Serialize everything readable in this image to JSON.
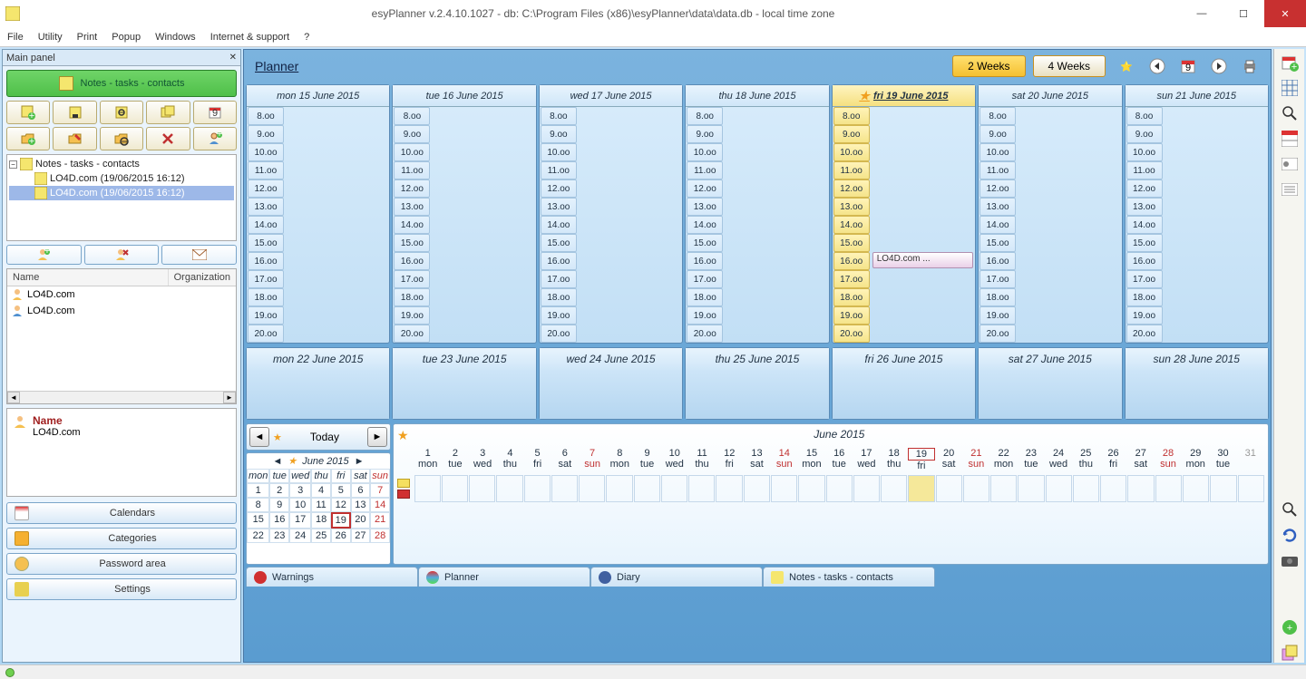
{
  "titlebar": {
    "title": "esyPlanner v.2.4.10.1027 - db: C:\\Program Files (x86)\\esyPlanner\\data\\data.db - local time zone"
  },
  "window_buttons": {
    "min": "—",
    "max": "☐",
    "close": "✕"
  },
  "menubar": [
    "File",
    "Utility",
    "Print",
    "Popup",
    "Windows",
    "Internet & support",
    "?"
  ],
  "leftpanel": {
    "header": "Main panel",
    "green_label": "Notes - tasks - contacts",
    "tree": {
      "root": "Notes - tasks - contacts",
      "items": [
        {
          "label": "LO4D.com (19/06/2015 16:12)",
          "selected": false
        },
        {
          "label": "LO4D.com (19/06/2015 16:12)",
          "selected": true
        }
      ]
    },
    "contacts": {
      "columns": [
        "Name",
        "Organization"
      ],
      "rows": [
        "LO4D.com",
        "LO4D.com"
      ]
    },
    "detail": {
      "name_label": "Name",
      "name_value": "LO4D.com"
    },
    "sections": [
      "Calendars",
      "Categories",
      "Password area",
      "Settings"
    ]
  },
  "planner": {
    "title": "Planner",
    "view_2w": "2 Weeks",
    "view_4w": "4 Weeks",
    "week1_headers": [
      "mon 15 June 2015",
      "tue 16 June 2015",
      "wed 17 June 2015",
      "thu 18 June 2015",
      "fri 19 June 2015",
      "sat 20 June 2015",
      "sun 21 June 2015"
    ],
    "today_index": 4,
    "hours": [
      "8.oo",
      "9.oo",
      "10.oo",
      "11.oo",
      "12.oo",
      "13.oo",
      "14.oo",
      "15.oo",
      "16.oo",
      "17.oo",
      "18.oo",
      "19.oo",
      "20.oo"
    ],
    "event": "LO4D.com  ...",
    "week2_headers": [
      "mon 22 June 2015",
      "tue 23 June 2015",
      "wed 24 June 2015",
      "thu 25 June 2015",
      "fri 26 June 2015",
      "sat 27 June 2015",
      "sun 28 June 2015"
    ]
  },
  "nav": {
    "today": "Today",
    "month": "June 2015"
  },
  "mini_calendar": {
    "month": "June 2015",
    "dow": [
      "mon",
      "tue",
      "wed",
      "thu",
      "fri",
      "sat",
      "sun"
    ],
    "weeks": [
      [
        1,
        2,
        3,
        4,
        5,
        6,
        7
      ],
      [
        8,
        9,
        10,
        11,
        12,
        13,
        14
      ],
      [
        15,
        16,
        17,
        18,
        19,
        20,
        21
      ],
      [
        22,
        23,
        24,
        25,
        26,
        27,
        28
      ]
    ],
    "today": 19
  },
  "timeline": {
    "title": "June 2015",
    "dow": [
      "mon",
      "tue",
      "wed",
      "thu",
      "fri",
      "sat",
      "sun",
      "mon",
      "tue",
      "wed",
      "thu",
      "fri",
      "sat",
      "sun",
      "mon",
      "tue",
      "wed",
      "thu",
      "fri",
      "sat",
      "sun",
      "mon",
      "tue",
      "wed",
      "thu",
      "fri",
      "sat",
      "sun",
      "mon",
      "tue"
    ]
  },
  "tabs": [
    "Warnings",
    "Planner",
    "Diary",
    "Notes - tasks - contacts"
  ]
}
